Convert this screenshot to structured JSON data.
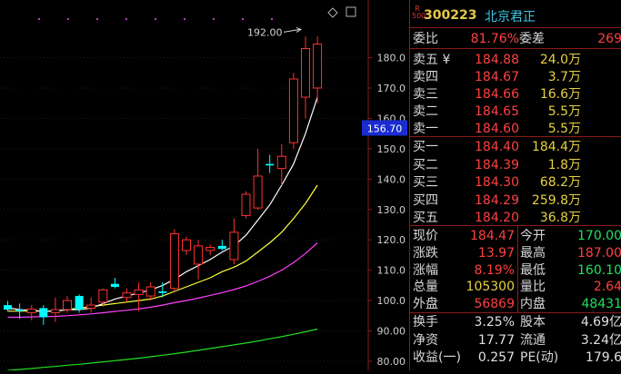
{
  "stock": {
    "tag": "R\n500",
    "code": "300223",
    "name": "北京君正"
  },
  "chart": {
    "max_label": "192.00",
    "y_ticks": [
      "180.0",
      "170.0",
      "160.0",
      "150.0",
      "140.0",
      "130.0",
      "120.0",
      "110.0",
      "100.0",
      "90.00",
      "80.00"
    ],
    "current_price": "156.70",
    "colors": {
      "up": "#ff3232",
      "down": "#00ffff",
      "ma5": "#ffffff",
      "ma10": "#ffff40",
      "ma20": "#ff40ff",
      "ma60": "#20e020",
      "panel_border": "#8a1a1a"
    }
  },
  "chart_data": {
    "type": "candlestick",
    "y_range": [
      77,
      199
    ],
    "candles": [
      {
        "o": 98.5,
        "h": 99.8,
        "l": 96.5,
        "c": 97.0
      },
      {
        "o": 97.0,
        "h": 99.0,
        "l": 94.0,
        "c": 96.5
      },
      {
        "o": 96.0,
        "h": 98.5,
        "l": 93.5,
        "c": 97.2
      },
      {
        "o": 97.5,
        "h": 98.5,
        "l": 92.0,
        "c": 94.5
      },
      {
        "o": 96.0,
        "h": 101.0,
        "l": 93.0,
        "c": 97.0
      },
      {
        "o": 97.0,
        "h": 101.5,
        "l": 96.0,
        "c": 100.0
      },
      {
        "o": 101.5,
        "h": 102.0,
        "l": 96.0,
        "c": 97.0
      },
      {
        "o": 97.5,
        "h": 101.0,
        "l": 96.0,
        "c": 98.5
      },
      {
        "o": 99.5,
        "h": 104.0,
        "l": 98.0,
        "c": 103.5
      },
      {
        "o": 105.5,
        "h": 107.5,
        "l": 104.0,
        "c": 104.5
      },
      {
        "o": 101.0,
        "h": 104.0,
        "l": 99.5,
        "c": 102.5
      },
      {
        "o": 102.0,
        "h": 106.0,
        "l": 96.5,
        "c": 103.5
      },
      {
        "o": 101.5,
        "h": 106.0,
        "l": 100.0,
        "c": 104.5
      },
      {
        "o": 103.0,
        "h": 106.0,
        "l": 101.0,
        "c": 102.5
      },
      {
        "o": 104.0,
        "h": 123.5,
        "l": 103.0,
        "c": 122.0
      },
      {
        "o": 116.5,
        "h": 121.0,
        "l": 115.0,
        "c": 120.0
      },
      {
        "o": 112.0,
        "h": 120.0,
        "l": 107.0,
        "c": 118.0
      },
      {
        "o": 116.5,
        "h": 118.5,
        "l": 115.0,
        "c": 117.5
      },
      {
        "o": 118.0,
        "h": 120.0,
        "l": 116.5,
        "c": 117.0
      },
      {
        "o": 113.5,
        "h": 127.0,
        "l": 112.0,
        "c": 122.5
      },
      {
        "o": 128.0,
        "h": 136.0,
        "l": 127.0,
        "c": 135.0
      },
      {
        "o": 130.5,
        "h": 150.0,
        "l": 130.0,
        "c": 141.0
      },
      {
        "o": 145.0,
        "h": 148.0,
        "l": 142.0,
        "c": 144.5
      },
      {
        "o": 143.5,
        "h": 151.5,
        "l": 138.0,
        "c": 147.5
      },
      {
        "o": 152.0,
        "h": 175.0,
        "l": 150.0,
        "c": 173.0
      },
      {
        "o": 167.0,
        "h": 187.0,
        "l": 160.0,
        "c": 183.0
      },
      {
        "o": 170.0,
        "h": 187.0,
        "l": 165.0,
        "c": 184.47
      }
    ],
    "ma5": [
      97.6,
      97.0,
      96.8,
      96.5,
      96.5,
      97.0,
      97.0,
      97.5,
      99.0,
      100.5,
      101.5,
      102.5,
      103.5,
      105.0,
      107.0,
      109.5,
      111.5,
      113.5,
      116.0,
      118.0,
      121.5,
      126.5,
      131.5,
      138.0,
      145.0,
      155.0,
      167.0
    ],
    "ma10": [
      96.5,
      96.5,
      96.5,
      96.5,
      96.6,
      97.0,
      97.5,
      98.0,
      98.5,
      99.0,
      99.5,
      100.0,
      100.5,
      101.5,
      103.0,
      104.5,
      106.0,
      107.5,
      109.5,
      111.0,
      113.0,
      116.0,
      119.0,
      122.5,
      127.0,
      132.0,
      138.0
    ],
    "ma20": [
      94.5,
      94.5,
      94.6,
      94.7,
      94.8,
      95.0,
      95.3,
      95.6,
      96.0,
      96.4,
      96.8,
      97.2,
      97.8,
      98.5,
      99.3,
      100.0,
      100.8,
      101.7,
      102.6,
      103.6,
      104.8,
      106.3,
      108.0,
      110.0,
      112.5,
      115.5,
      119.0
    ],
    "ma60": [
      77.0,
      77.3,
      77.6,
      78.0,
      78.3,
      78.7,
      79.0,
      79.4,
      79.8,
      80.2,
      80.6,
      81.0,
      81.5,
      82.0,
      82.5,
      83.0,
      83.6,
      84.2,
      84.8,
      85.4,
      86.0,
      86.7,
      87.4,
      88.1,
      88.9,
      89.7,
      90.6
    ]
  },
  "quote": {
    "wb_label": "委比",
    "wb_value": "81.76%",
    "wc_label": "委差",
    "wc_value": "269",
    "asks": [
      {
        "label": "卖五 ¥",
        "price": "184.88",
        "vol": "24.0万"
      },
      {
        "label": "卖四",
        "price": "184.67",
        "vol": "3.7万"
      },
      {
        "label": "卖三",
        "price": "184.66",
        "vol": "16.6万"
      },
      {
        "label": "卖二",
        "price": "184.65",
        "vol": "5.5万"
      },
      {
        "label": "卖一",
        "price": "184.60",
        "vol": "5.5万"
      }
    ],
    "bids": [
      {
        "label": "买一",
        "price": "184.40",
        "vol": "184.4万"
      },
      {
        "label": "买二",
        "price": "184.39",
        "vol": "1.8万"
      },
      {
        "label": "买三",
        "price": "184.30",
        "vol": "68.2万"
      },
      {
        "label": "买四",
        "price": "184.29",
        "vol": "259.8万"
      },
      {
        "label": "买五",
        "price": "184.20",
        "vol": "36.8万"
      }
    ],
    "stats": [
      {
        "l1": "现价",
        "v1": "184.47",
        "c1": "red",
        "l2": "今开",
        "v2": "170.00",
        "c2": "grn"
      },
      {
        "l1": "涨跌",
        "v1": "13.97",
        "c1": "red",
        "l2": "最高",
        "v2": "187.00",
        "c2": "red"
      },
      {
        "l1": "涨幅",
        "v1": "8.19%",
        "c1": "red",
        "l2": "最低",
        "v2": "160.10",
        "c2": "grn"
      },
      {
        "l1": "总量",
        "v1": "105300",
        "c1": "yel",
        "l2": "量比",
        "v2": "2.64",
        "c2": "red"
      },
      {
        "l1": "外盘",
        "v1": "56869",
        "c1": "red",
        "l2": "内盘",
        "v2": "48431",
        "c2": "grn"
      }
    ],
    "stats2": [
      {
        "l1": "换手",
        "v1": "3.25%",
        "l2": "股本",
        "v2": "4.69亿"
      },
      {
        "l1": "净资",
        "v1": "17.77",
        "l2": "流通",
        "v2": "3.24亿"
      },
      {
        "l1": "收益(一)",
        "v1": "0.257",
        "l2": "PE(动)",
        "v2": "179.6"
      }
    ]
  }
}
